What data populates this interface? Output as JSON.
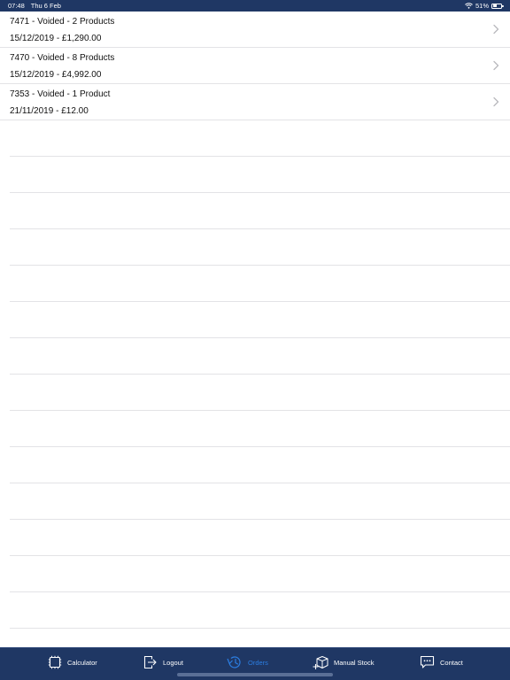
{
  "status_bar": {
    "time": "07:48",
    "date": "Thu 6 Feb",
    "battery_percent": "51%",
    "battery_level": 0.51
  },
  "orders": [
    {
      "title": "7471 - Voided - 2 Products",
      "subtitle": "15/12/2019 - £1,290.00"
    },
    {
      "title": "7470 - Voided - 8 Products",
      "subtitle": "15/12/2019 - £4,992.00"
    },
    {
      "title": "7353 - Voided - 1 Product",
      "subtitle": "21/11/2019 - £12.00"
    }
  ],
  "tab_bar": {
    "tabs": [
      {
        "label": "Calculator",
        "icon": "calculator-icon",
        "active": false
      },
      {
        "label": "Logout",
        "icon": "logout-icon",
        "active": false
      },
      {
        "label": "Orders",
        "icon": "orders-history-icon",
        "active": true
      },
      {
        "label": "Manual Stock",
        "icon": "box-add-icon",
        "active": false
      },
      {
        "label": "Contact",
        "icon": "chat-icon",
        "active": false
      }
    ],
    "active_color": "#2b7de1",
    "background_color": "#1f3764"
  }
}
